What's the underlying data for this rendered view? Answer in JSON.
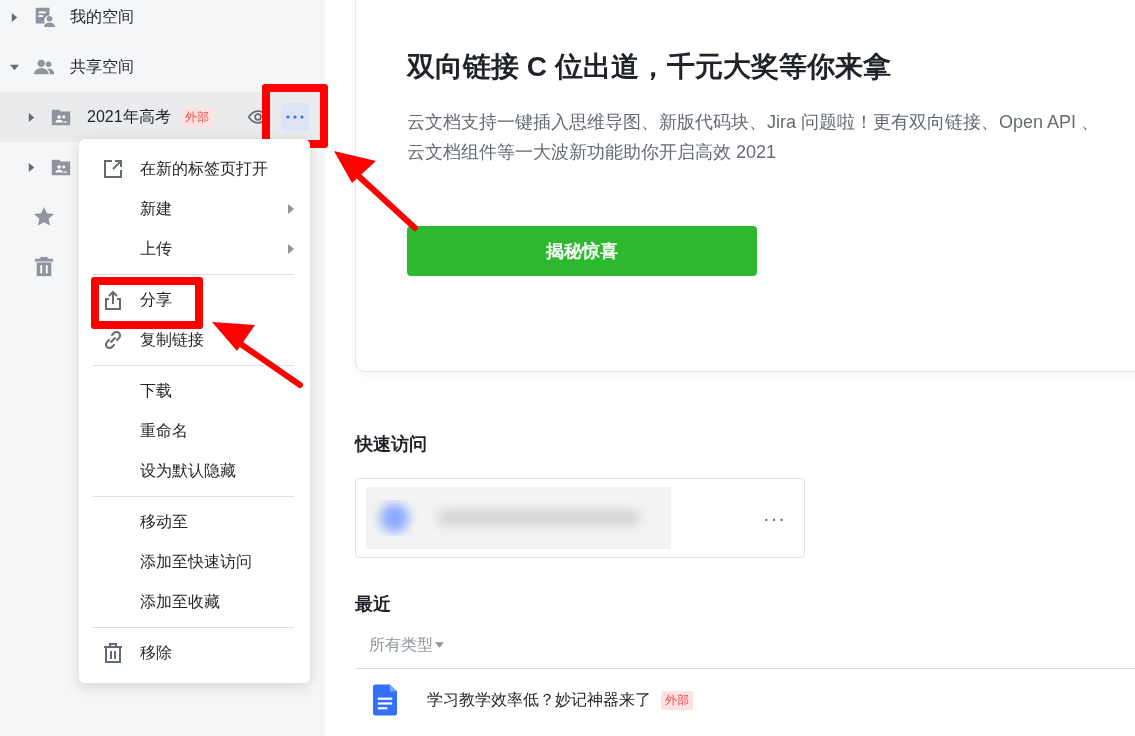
{
  "sidebar": {
    "items": [
      {
        "kind": "personal",
        "label": "我的空间",
        "expanded": false
      },
      {
        "kind": "shared",
        "label": "共享空间",
        "expanded": true,
        "children": [
          {
            "kind": "folder",
            "label": "2021年高考",
            "tag": "外部",
            "expanded": false,
            "selected": true,
            "more_highlighted": true
          },
          {
            "kind": "folder",
            "expanded": false,
            "selected": false,
            "more_highlighted": false
          }
        ]
      },
      {
        "kind": "starred"
      },
      {
        "kind": "trash"
      }
    ]
  },
  "context_menu": {
    "groups": [
      [
        {
          "label": "在新的标签页打开",
          "submenu": false,
          "highlighted": false
        },
        {
          "label": "新建",
          "submenu": true,
          "highlighted": false
        },
        {
          "label": "上传",
          "submenu": true,
          "highlighted": false
        }
      ],
      [
        {
          "label": "分享",
          "submenu": false,
          "highlighted": true
        },
        {
          "label": "复制链接",
          "submenu": false,
          "highlighted": false
        }
      ],
      [
        {
          "label": "下载",
          "submenu": false,
          "highlighted": false
        },
        {
          "label": "重命名",
          "submenu": false,
          "highlighted": false
        },
        {
          "label": "设为默认隐藏",
          "submenu": false,
          "highlighted": false
        }
      ],
      [
        {
          "label": "移动至",
          "submenu": false,
          "highlighted": false
        },
        {
          "label": "添加至快速访问",
          "submenu": false,
          "highlighted": false
        },
        {
          "label": "添加至收藏",
          "submenu": false,
          "highlighted": false
        }
      ],
      [
        {
          "label": "移除",
          "submenu": false,
          "highlighted": false
        }
      ]
    ]
  },
  "banner": {
    "title": "双向链接 C 位出道，千元大奖等你来拿",
    "description": "云文档支持一键插入思维导图、新版代码块、Jira 问题啦！更有双向链接、Open API 、云文档组件等一大波新功能助你开启高效 2021",
    "button": "揭秘惊喜"
  },
  "quick_access": {
    "title": "快速访问",
    "items": [
      {
        "kind": "picture",
        "more": "···"
      }
    ]
  },
  "recent": {
    "title": "最近",
    "filter": "所有类型",
    "rows": [
      {
        "title": "学习教学效率低？妙记神器来了",
        "tag": "外部"
      }
    ]
  }
}
